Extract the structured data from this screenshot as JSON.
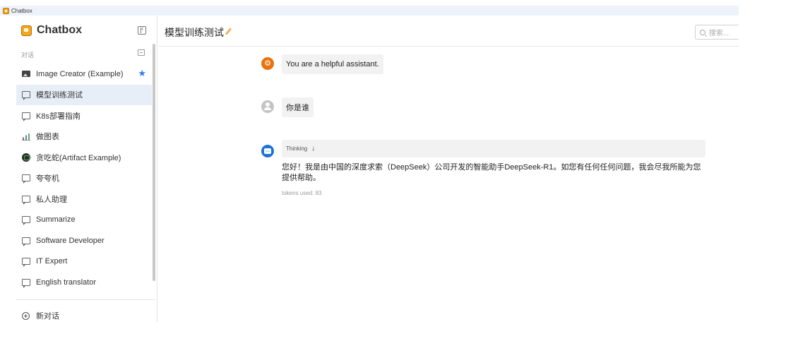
{
  "window": {
    "title": "Chatbox"
  },
  "sidebar": {
    "brand": "Chatbox",
    "section_label": "对话",
    "sessions": [
      {
        "label": "Image Creator (Example)",
        "icon": "image-icon",
        "starred": true
      },
      {
        "label": "模型训练测试",
        "icon": "chat-icon",
        "active": true
      },
      {
        "label": "K8s部署指南",
        "icon": "chat-icon"
      },
      {
        "label": "做图表",
        "icon": "chart-icon"
      },
      {
        "label": "贪吃蛇(Artifact Example)",
        "icon": "snake-avatar-icon"
      },
      {
        "label": "夸夸机",
        "icon": "chat-icon"
      },
      {
        "label": "私人助理",
        "icon": "chat-icon"
      },
      {
        "label": "Summarize",
        "icon": "chat-icon"
      },
      {
        "label": "Software Developer",
        "icon": "chat-icon"
      },
      {
        "label": "IT Expert",
        "icon": "chat-icon"
      },
      {
        "label": "English translator",
        "icon": "chat-icon"
      }
    ],
    "new_chat_label": "新对话"
  },
  "header": {
    "title": "模型训练测试",
    "search_placeholder": "搜索..."
  },
  "messages": {
    "system": "You are a helpful assistant.",
    "user": "你是谁",
    "assistant_thinking_label": "Thinking",
    "assistant_reply": "您好！我是由中国的深度求索（DeepSeek）公司开发的智能助手DeepSeek-R1。如您有任何任何问题，我会尽我所能为您提供帮助。",
    "tokens_used": "tokens used: 83"
  },
  "colors": {
    "accent": "#1e73d6",
    "system_avatar": "#e8730a",
    "active_session_bg": "#e8eef7",
    "star": "#2b7de9"
  }
}
